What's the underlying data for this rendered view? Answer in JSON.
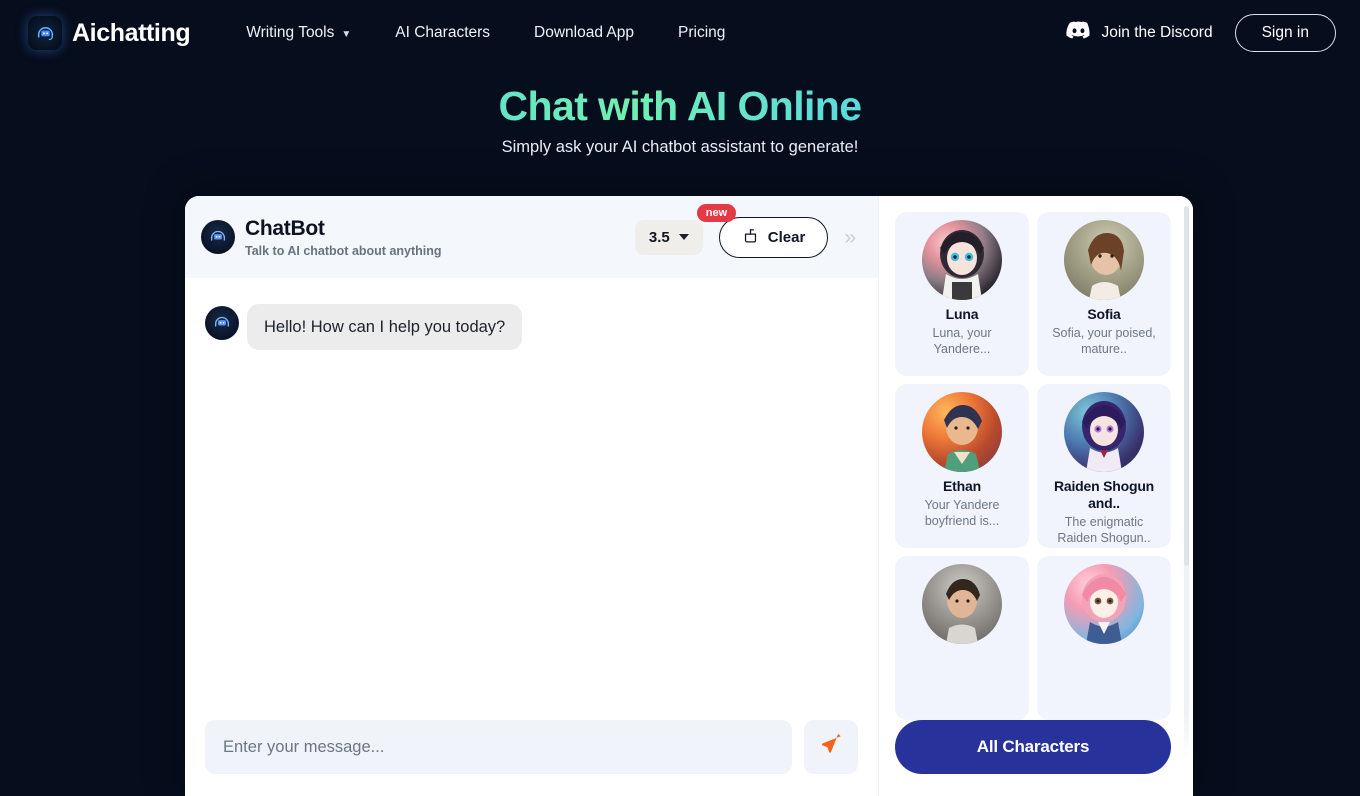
{
  "header": {
    "brand": "Aichatting",
    "logo_icon": "chatbot-headset-icon",
    "nav": [
      {
        "label": "Writing Tools",
        "has_dropdown": true
      },
      {
        "label": "AI Characters",
        "has_dropdown": false
      },
      {
        "label": "Download App",
        "has_dropdown": false
      },
      {
        "label": "Pricing",
        "has_dropdown": false
      }
    ],
    "discord": {
      "label": "Join the Discord",
      "icon": "discord-icon"
    },
    "signin": "Sign in"
  },
  "hero": {
    "title": "Chat with AI Online",
    "subtitle": "Simply ask your AI chatbot assistant to generate!",
    "gradient_from": "#3d8bff",
    "gradient_mid": "#71efb3",
    "gradient_to": "#7b6ef0"
  },
  "chat": {
    "title": "ChatBot",
    "subtitle": "Talk to AI chatbot about anything",
    "avatar_icon": "chatbot-avatar-icon",
    "model": {
      "value": "3.5",
      "badge": "new"
    },
    "clear_label": "Clear",
    "clear_icon": "broom-icon",
    "collapse_icon": "chevron-double-right-icon",
    "messages": [
      {
        "role": "assistant",
        "text": "Hello! How can I help you today?"
      }
    ],
    "input_placeholder": "Enter your message...",
    "input_value": "",
    "send_icon": "paper-plane-icon",
    "send_icon_color": "#f4631e"
  },
  "characters": {
    "all_button": "All Characters",
    "all_button_color": "#27339b",
    "cards": [
      {
        "name": "Luna",
        "desc": "Luna, your Yandere...",
        "avatar": "anime-girl-dark-hair"
      },
      {
        "name": "Sofia",
        "desc": "Sofia, your poised, mature..",
        "avatar": "photo-woman-brown-hair"
      },
      {
        "name": "Ethan",
        "desc": "Your Yandere boyfriend is...",
        "avatar": "anime-boy-autumn"
      },
      {
        "name": "Raiden Shogun and..",
        "desc": "The enigmatic Raiden Shogun..",
        "avatar": "anime-girl-purple-hair"
      },
      {
        "name": "",
        "desc": "",
        "avatar": "photo-man-dark-hair"
      },
      {
        "name": "",
        "desc": "",
        "avatar": "anime-girl-pink-hair"
      }
    ]
  }
}
